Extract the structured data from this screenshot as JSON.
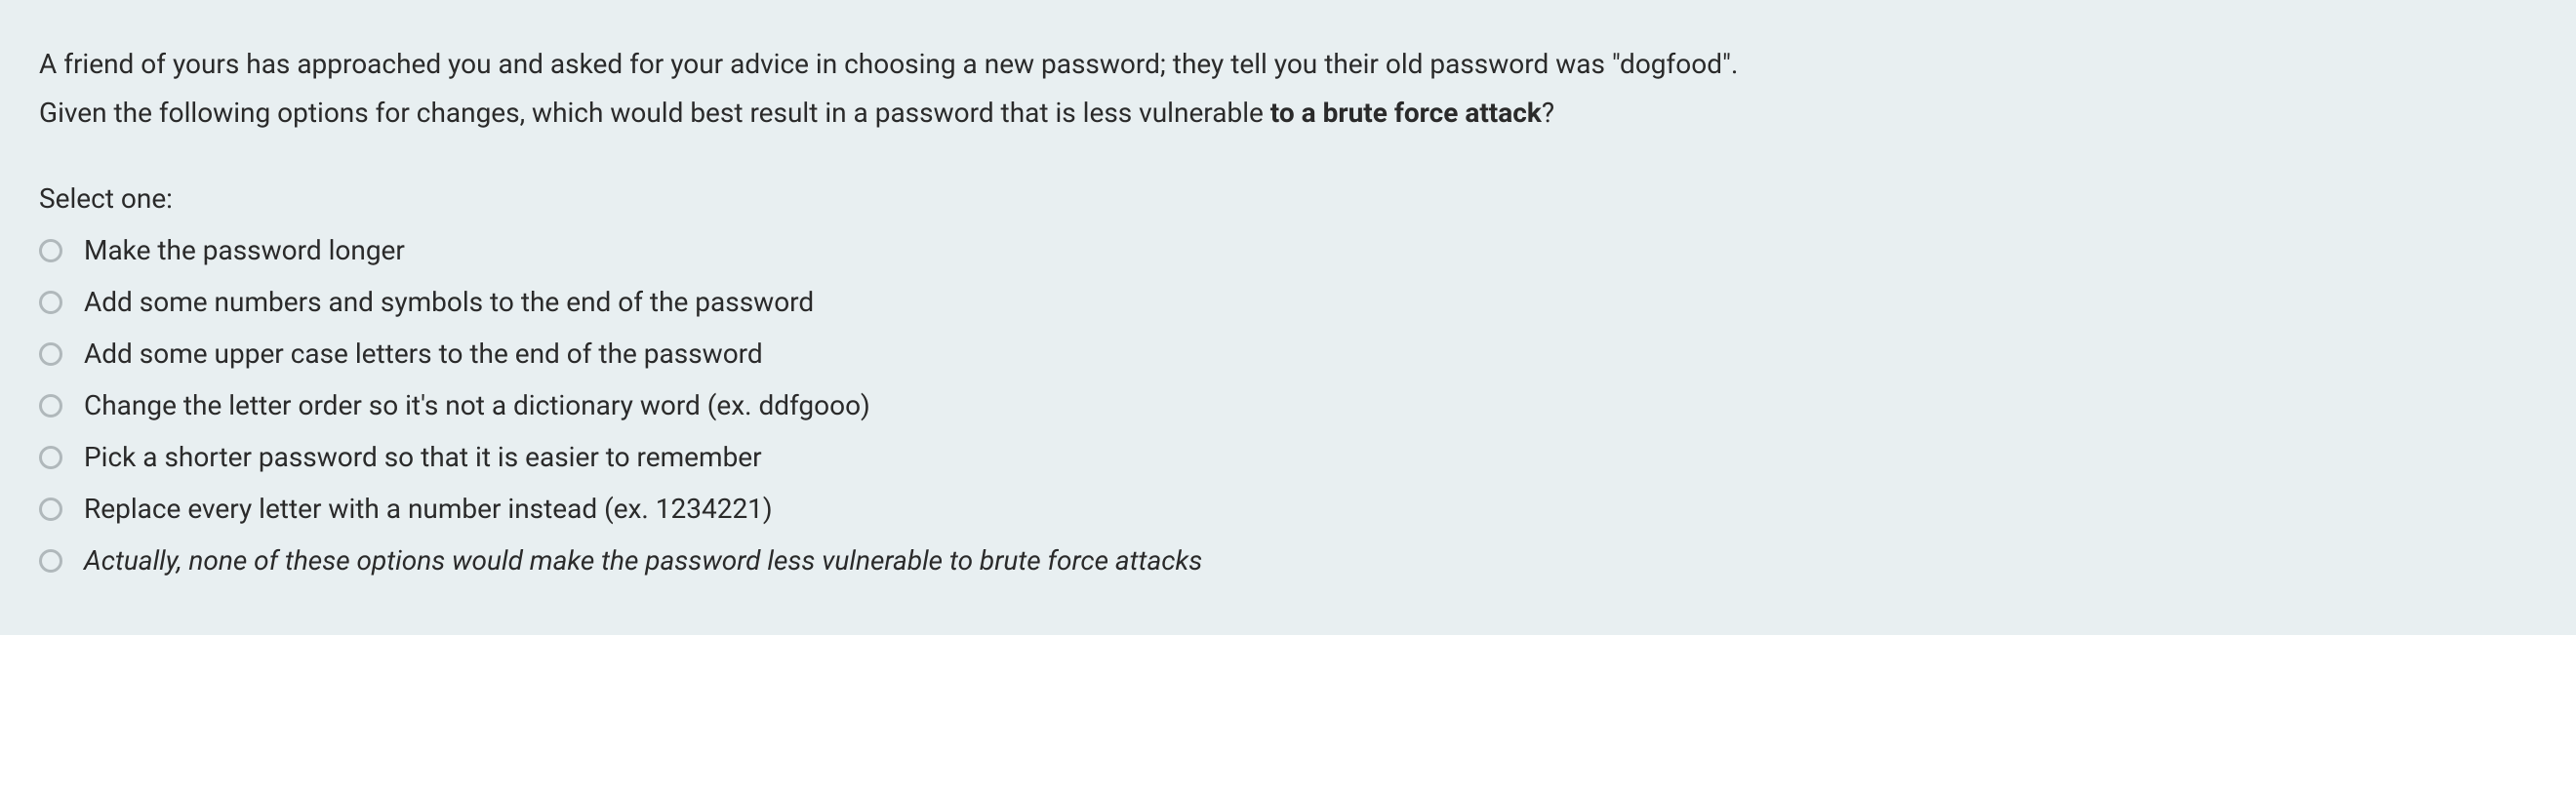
{
  "question": {
    "line1": "A friend of yours has approached you and asked for your advice in choosing a new password; they tell you their old password was \"dogfood\".",
    "line2_pre": "Given the following options for changes, which would best result in a password that is less vulnerable ",
    "line2_bold": "to a brute force attack",
    "line2_post": "?"
  },
  "selectLabel": "Select one:",
  "options": [
    {
      "text": "Make the password longer",
      "italic": false
    },
    {
      "text": "Add some numbers and symbols to the end of the password",
      "italic": false
    },
    {
      "text": "Add some upper case letters to the end of the password",
      "italic": false
    },
    {
      "text": "Change the letter order so it's not a dictionary word (ex. ddfgooo)",
      "italic": false
    },
    {
      "text": "Pick a shorter password so that it is easier to remember",
      "italic": false
    },
    {
      "text": "Replace every letter with a number instead (ex. 1234221)",
      "italic": false
    },
    {
      "text": "Actually, none of these options would make the password less vulnerable to brute force attacks",
      "italic": true
    }
  ]
}
